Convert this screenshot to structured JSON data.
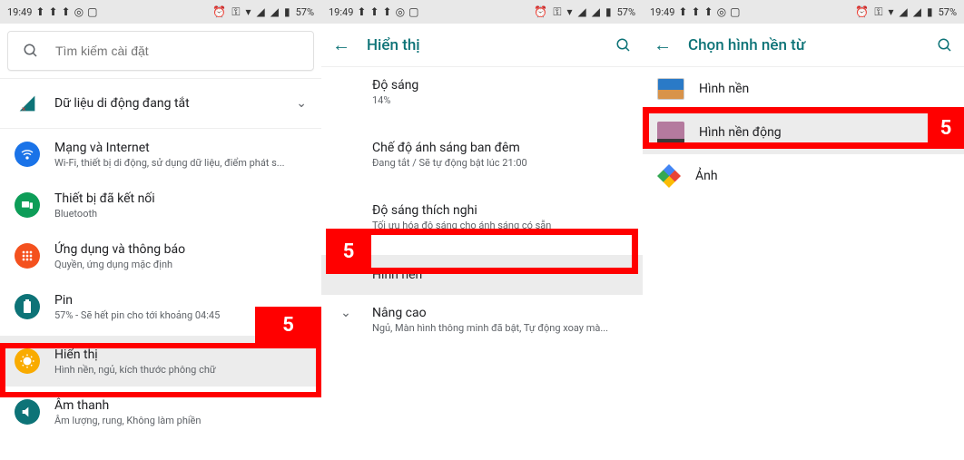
{
  "status": {
    "time": "19:49",
    "battery_text": "57%",
    "left_icons": [
      "upload-icon",
      "upload-icon",
      "upload-icon",
      "target-icon",
      "instagram-icon"
    ],
    "right_icons": [
      "alarm-icon",
      "vpn-icon",
      "wifi-icon",
      "signal1-icon",
      "signal2-icon",
      "battery-icon"
    ]
  },
  "panel1": {
    "search_placeholder": "Tìm kiếm cài đặt",
    "data_toggle": {
      "title": "Dữ liệu di động đang tắt"
    },
    "items": [
      {
        "title": "Mạng và Internet",
        "sub": "Wi-Fi, thiết bị di động, sử dụng dữ liệu, điểm phát s...",
        "color": "#1a73e8",
        "icon": "wifi-icon"
      },
      {
        "title": "Thiết bị đã kết nối",
        "sub": "Bluetooth",
        "color": "#0d9d58",
        "icon": "devices-icon"
      },
      {
        "title": "Ứng dụng và thông báo",
        "sub": "Quyền, ứng dụng mặc định",
        "color": "#f4511e",
        "icon": "apps-icon"
      },
      {
        "title": "Pin",
        "sub": "57% - Sẽ hết pin cho tới khoảng 04:45",
        "color": "#0d7377",
        "icon": "battery-icon"
      },
      {
        "title": "Hiển thị",
        "sub": "Hình nền, ngủ, kích thước phông chữ",
        "color": "#f9ab00",
        "icon": "brightness-icon"
      },
      {
        "title": "Âm thanh",
        "sub": "Âm lượng, rung, Không làm phiền",
        "color": "#0d7377",
        "icon": "sound-icon"
      }
    ],
    "step_label": "5"
  },
  "panel2": {
    "title": "Hiển thị",
    "items": [
      {
        "title": "Độ sáng",
        "sub": "14%"
      },
      {
        "title": "Chế độ ánh sáng ban đêm",
        "sub": "Đang tắt / Sẽ tự động bật lúc 21:00"
      },
      {
        "title": "Độ sáng thích nghi",
        "sub": "Tối ưu hóa độ sáng cho ánh sáng có sẵn"
      },
      {
        "title": "Hình nền",
        "sub": ""
      },
      {
        "title": "Nâng cao",
        "sub": "Ngủ, Màn hình thông minh đã bật, Tự động xoay mà..."
      }
    ],
    "step_label": "5"
  },
  "panel3": {
    "title": "Chọn hình nền từ",
    "items": [
      {
        "title": "Hình nền"
      },
      {
        "title": "Hình nền động"
      },
      {
        "title": "Ảnh"
      }
    ],
    "step_label": "5"
  }
}
